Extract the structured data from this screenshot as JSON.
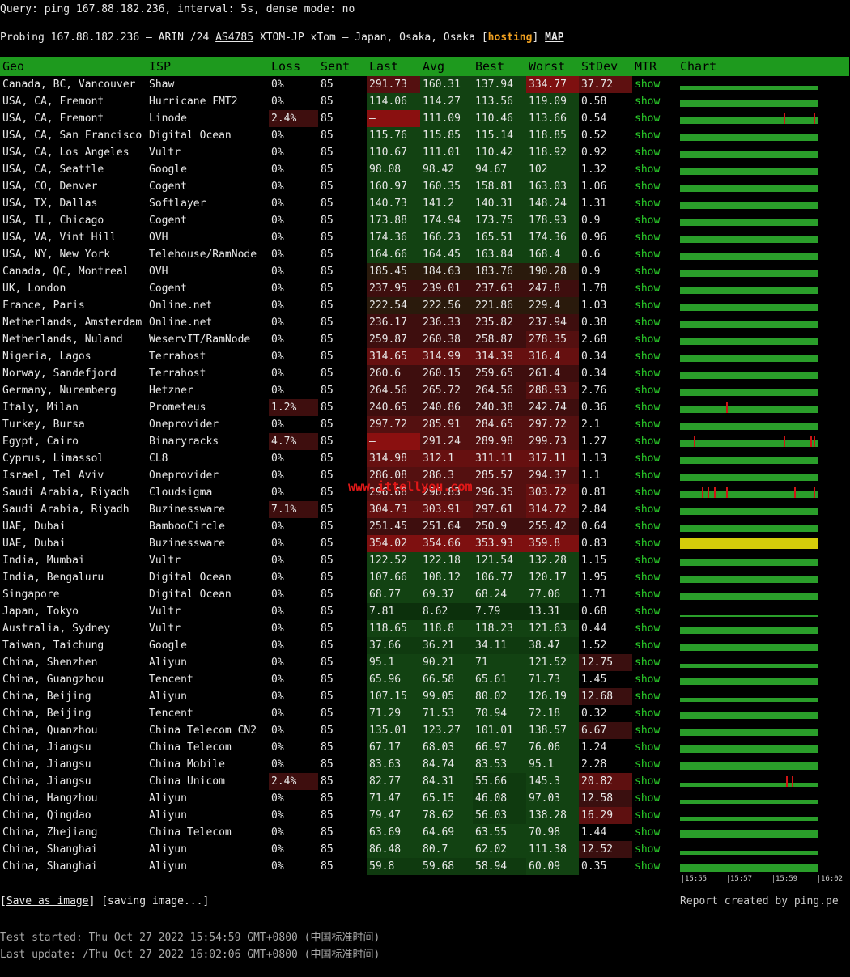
{
  "query": "Query: ping 167.88.182.236, interval: 5s, dense mode: no",
  "probe": {
    "prefix": "Probing 167.88.182.236 — ARIN /24 ",
    "asn": "AS4785",
    "mid": " XTOM-JP xTom — Japan, Osaka, Osaka [",
    "hosting": "hosting",
    "close": "] ",
    "map": "MAP"
  },
  "columns": [
    "Geo",
    "ISP",
    "Loss",
    "Sent",
    "Last",
    "Avg",
    "Best",
    "Worst",
    "StDev",
    "MTR",
    "Chart"
  ],
  "show_label": "show",
  "rows": [
    [
      "Canada, BC, Vancouver",
      "Shaw",
      "0%",
      "85",
      "291.73",
      "160.31",
      "137.94",
      "334.77",
      "37.72"
    ],
    [
      "USA, CA, Fremont",
      "Hurricane FMT2",
      "0%",
      "85",
      "114.06",
      "114.27",
      "113.56",
      "119.09",
      "0.58"
    ],
    [
      "USA, CA, Fremont",
      "Linode",
      "2.4%",
      "85",
      "–",
      "111.09",
      "110.46",
      "113.66",
      "0.54"
    ],
    [
      "USA, CA, San Francisco",
      "Digital Ocean",
      "0%",
      "85",
      "115.76",
      "115.85",
      "115.14",
      "118.85",
      "0.52"
    ],
    [
      "USA, CA, Los Angeles",
      "Vultr",
      "0%",
      "85",
      "110.67",
      "111.01",
      "110.42",
      "118.92",
      "0.92"
    ],
    [
      "USA, CA, Seattle",
      "Google",
      "0%",
      "85",
      "98.08",
      "98.42",
      "94.67",
      "102",
      "1.32"
    ],
    [
      "USA, CO, Denver",
      "Cogent",
      "0%",
      "85",
      "160.97",
      "160.35",
      "158.81",
      "163.03",
      "1.06"
    ],
    [
      "USA, TX, Dallas",
      "Softlayer",
      "0%",
      "85",
      "140.73",
      "141.2",
      "140.31",
      "148.24",
      "1.31"
    ],
    [
      "USA, IL, Chicago",
      "Cogent",
      "0%",
      "85",
      "173.88",
      "174.94",
      "173.75",
      "178.93",
      "0.9"
    ],
    [
      "USA, VA, Vint Hill",
      "OVH",
      "0%",
      "85",
      "174.36",
      "166.23",
      "165.51",
      "174.36",
      "0.96"
    ],
    [
      "USA, NY, New York",
      "Telehouse/RamNode",
      "0%",
      "85",
      "164.66",
      "164.45",
      "163.84",
      "168.4",
      "0.6"
    ],
    [
      "Canada, QC, Montreal",
      "OVH",
      "0%",
      "85",
      "185.45",
      "184.63",
      "183.76",
      "190.28",
      "0.9"
    ],
    [
      "UK, London",
      "Cogent",
      "0%",
      "85",
      "237.95",
      "239.01",
      "237.63",
      "247.8",
      "1.78"
    ],
    [
      "France, Paris",
      "Online.net",
      "0%",
      "85",
      "222.54",
      "222.56",
      "221.86",
      "229.4",
      "1.03"
    ],
    [
      "Netherlands, Amsterdam",
      "Online.net",
      "0%",
      "85",
      "236.17",
      "236.33",
      "235.82",
      "237.94",
      "0.38"
    ],
    [
      "Netherlands, Nuland",
      "WeservIT/RamNode",
      "0%",
      "85",
      "259.87",
      "260.38",
      "258.87",
      "278.35",
      "2.68"
    ],
    [
      "Nigeria, Lagos",
      "Terrahost",
      "0%",
      "85",
      "314.65",
      "314.99",
      "314.39",
      "316.4",
      "0.34"
    ],
    [
      "Norway, Sandefjord",
      "Terrahost",
      "0%",
      "85",
      "260.6",
      "260.15",
      "259.65",
      "261.4",
      "0.34"
    ],
    [
      "Germany, Nuremberg",
      "Hetzner",
      "0%",
      "85",
      "264.56",
      "265.72",
      "264.56",
      "288.93",
      "2.76"
    ],
    [
      "Italy, Milan",
      "Prometeus",
      "1.2%",
      "85",
      "240.65",
      "240.86",
      "240.38",
      "242.74",
      "0.36"
    ],
    [
      "Turkey, Bursa",
      "Oneprovider",
      "0%",
      "85",
      "297.72",
      "285.91",
      "284.65",
      "297.72",
      "2.1"
    ],
    [
      "Egypt, Cairo",
      "Binaryracks",
      "4.7%",
      "85",
      "–",
      "291.24",
      "289.98",
      "299.73",
      "1.27"
    ],
    [
      "Cyprus, Limassol",
      "CL8",
      "0%",
      "85",
      "314.98",
      "312.1",
      "311.11",
      "317.11",
      "1.13"
    ],
    [
      "Israel, Tel Aviv",
      "Oneprovider",
      "0%",
      "85",
      "286.08",
      "286.3",
      "285.57",
      "294.37",
      "1.1"
    ],
    [
      "Saudi Arabia, Riyadh",
      "Cloudsigma",
      "0%",
      "85",
      "296.68",
      "296.83",
      "296.35",
      "303.72",
      "0.81"
    ],
    [
      "Saudi Arabia, Riyadh",
      "Buzinessware",
      "7.1%",
      "85",
      "304.73",
      "303.91",
      "297.61",
      "314.72",
      "2.84"
    ],
    [
      "UAE, Dubai",
      "BambooCircle",
      "0%",
      "85",
      "251.45",
      "251.64",
      "250.9",
      "255.42",
      "0.64"
    ],
    [
      "UAE, Dubai",
      "Buzinessware",
      "0%",
      "85",
      "354.02",
      "354.66",
      "353.93",
      "359.8",
      "0.83"
    ],
    [
      "India, Mumbai",
      "Vultr",
      "0%",
      "85",
      "122.52",
      "122.18",
      "121.54",
      "132.28",
      "1.15"
    ],
    [
      "India, Bengaluru",
      "Digital Ocean",
      "0%",
      "85",
      "107.66",
      "108.12",
      "106.77",
      "120.17",
      "1.95"
    ],
    [
      "Singapore",
      "Digital Ocean",
      "0%",
      "85",
      "68.77",
      "69.37",
      "68.24",
      "77.06",
      "1.71"
    ],
    [
      "Japan, Tokyo",
      "Vultr",
      "0%",
      "85",
      "7.81",
      "8.62",
      "7.79",
      "13.31",
      "0.68"
    ],
    [
      "Australia, Sydney",
      "Vultr",
      "0%",
      "85",
      "118.65",
      "118.8",
      "118.23",
      "121.63",
      "0.44"
    ],
    [
      "Taiwan, Taichung",
      "Google",
      "0%",
      "85",
      "37.66",
      "36.21",
      "34.11",
      "38.47",
      "1.52"
    ],
    [
      "China, Shenzhen",
      "Aliyun",
      "0%",
      "85",
      "95.1",
      "90.21",
      "71",
      "121.52",
      "12.75"
    ],
    [
      "China, Guangzhou",
      "Tencent",
      "0%",
      "85",
      "65.96",
      "66.58",
      "65.61",
      "71.73",
      "1.45"
    ],
    [
      "China, Beijing",
      "Aliyun",
      "0%",
      "85",
      "107.15",
      "99.05",
      "80.02",
      "126.19",
      "12.68"
    ],
    [
      "China, Beijing",
      "Tencent",
      "0%",
      "85",
      "71.29",
      "71.53",
      "70.94",
      "72.18",
      "0.32"
    ],
    [
      "China, Quanzhou",
      "China Telecom CN2",
      "0%",
      "85",
      "135.01",
      "123.27",
      "101.01",
      "138.57",
      "6.67"
    ],
    [
      "China, Jiangsu",
      "China Telecom",
      "0%",
      "85",
      "67.17",
      "68.03",
      "66.97",
      "76.06",
      "1.24"
    ],
    [
      "China, Jiangsu",
      "China Mobile",
      "0%",
      "85",
      "83.63",
      "84.74",
      "83.53",
      "95.1",
      "2.28"
    ],
    [
      "China, Jiangsu",
      "China Unicom",
      "2.4%",
      "85",
      "82.77",
      "84.31",
      "55.66",
      "145.3",
      "20.82"
    ],
    [
      "China, Hangzhou",
      "Aliyun",
      "0%",
      "85",
      "71.47",
      "65.15",
      "46.08",
      "97.03",
      "12.58"
    ],
    [
      "China, Qingdao",
      "Aliyun",
      "0%",
      "85",
      "79.47",
      "78.62",
      "56.03",
      "138.28",
      "16.29"
    ],
    [
      "China, Zhejiang",
      "China Telecom",
      "0%",
      "85",
      "63.69",
      "64.69",
      "63.55",
      "70.98",
      "1.44"
    ],
    [
      "China, Shanghai",
      "Aliyun",
      "0%",
      "85",
      "86.48",
      "80.7",
      "62.02",
      "111.38",
      "12.52"
    ],
    [
      "China, Shanghai",
      "Aliyun",
      "0%",
      "85",
      "59.8",
      "59.68",
      "58.94",
      "60.09",
      "0.35"
    ]
  ],
  "axis_labels": [
    "15:55",
    "15:57",
    "15:59",
    "16:02"
  ],
  "save": {
    "bracket_open": "[",
    "save_label": "Save as image",
    "rest": "] [saving image...]"
  },
  "report": "Report created by ping.pe",
  "test_started": "Test started: Thu Oct 27 2022 15:54:59 GMT+0800 (中国标准时间)",
  "last_update": "Last update: /Thu Oct 27 2022 16:02:06 GMT+0800 (中国标准时间)",
  "watermark": "www.ittellyou.com",
  "colors": {
    "header_green": "#1e9a1e",
    "show_green": "#2bd02b",
    "bar_green": "#2a9e2a",
    "loss_red": "#d01515",
    "hosting_orange": "#f0a020",
    "highlight_yellow": "#d4cc0a"
  }
}
